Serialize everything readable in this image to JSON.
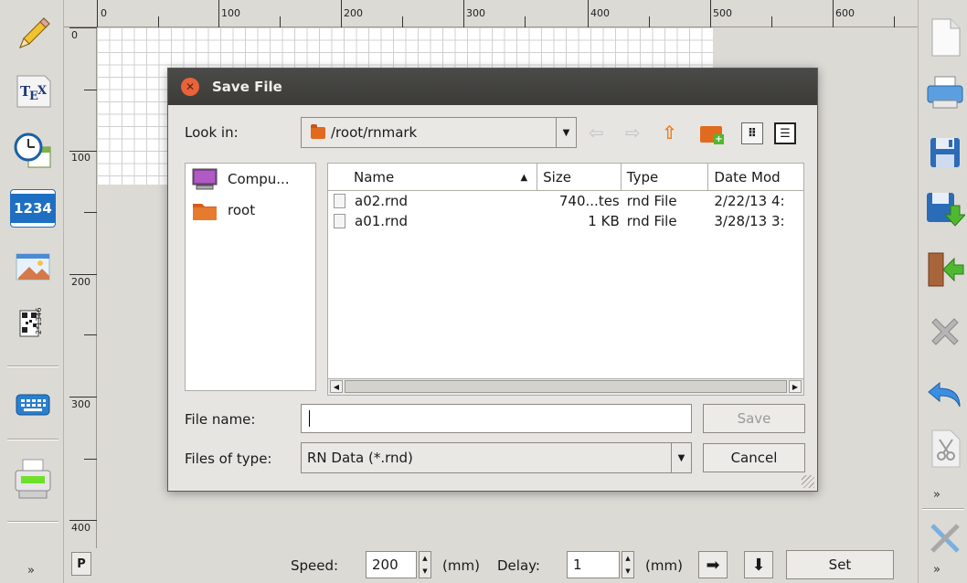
{
  "ruler": {
    "top_labels": [
      "0",
      "100",
      "200",
      "300",
      "400",
      "500",
      "600"
    ],
    "left_labels": [
      "0",
      "100",
      "200",
      "300",
      "400"
    ]
  },
  "left_toolbar": {
    "icons": [
      "pencil-icon",
      "tex-icon",
      "clock-icon",
      "counter-icon",
      "image-icon",
      "barcode-icon",
      "keyboard-icon",
      "printer-icon"
    ],
    "counter_text": "1234",
    "tex_text": "TEX"
  },
  "right_toolbar": {
    "icons": [
      "new-file-icon",
      "print-icon",
      "save-icon",
      "save-as-icon",
      "exit-icon",
      "delete-icon",
      "undo-icon",
      "cut-icon",
      "tools-icon"
    ]
  },
  "bottom": {
    "p_label": "P",
    "speed_label": "Speed:",
    "speed_value": "200",
    "speed_unit": "(mm)",
    "delay_label": "Delay:",
    "delay_value": "1",
    "delay_unit": "(mm)",
    "set_label": "Set"
  },
  "dialog": {
    "title": "Save File",
    "look_in_label": "Look in:",
    "look_in_value": "/root/rnmark",
    "places": [
      {
        "label": "Compu...",
        "icon": "computer-icon"
      },
      {
        "label": "root",
        "icon": "folder-icon"
      }
    ],
    "columns": [
      "Name",
      "Size",
      "Type",
      "Date Mod"
    ],
    "files": [
      {
        "name": "a02.rnd",
        "size": "740...tes",
        "type": "rnd File",
        "date": "2/22/13 4:"
      },
      {
        "name": "a01.rnd",
        "size": "1 KB",
        "type": "rnd File",
        "date": "3/28/13 3:"
      }
    ],
    "file_name_label": "File name:",
    "file_name_value": "",
    "files_of_type_label": "Files of type:",
    "files_of_type_value": "RN Data (*.rnd)",
    "save_label": "Save",
    "cancel_label": "Cancel"
  }
}
